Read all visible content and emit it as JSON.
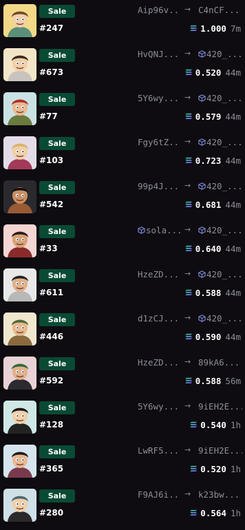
{
  "sales": [
    {
      "badge": "Sale",
      "number": "#247",
      "from": "Aip96v...",
      "from_icon": false,
      "to": "C4nCF...",
      "to_icon": false,
      "price": "1.000",
      "age": "7m",
      "colors": {
        "bg": "#f3d987",
        "skin": "#f1cfa8",
        "hair": "#6b4a2a",
        "shirt": "#5a8f7a"
      }
    },
    {
      "badge": "Sale",
      "number": "#673",
      "from": "HvQNJ...",
      "from_icon": false,
      "to": "420_...",
      "to_icon": true,
      "price": "0.520",
      "age": "44m",
      "colors": {
        "bg": "#f3e6c8",
        "skin": "#f1cfa8",
        "hair": "#3a2a22",
        "shirt": "#c8c3bd"
      }
    },
    {
      "badge": "Sale",
      "number": "#77",
      "from": "5Y6wy...",
      "from_icon": false,
      "to": "420_...",
      "to_icon": true,
      "price": "0.579",
      "age": "44m",
      "colors": {
        "bg": "#c9e3e4",
        "skin": "#e9b993",
        "hair": "#b22b2b",
        "shirt": "#6b7a3e"
      }
    },
    {
      "badge": "Sale",
      "number": "#103",
      "from": "Fgy6tZ...",
      "from_icon": false,
      "to": "420_...",
      "to_icon": true,
      "price": "0.723",
      "age": "44m",
      "colors": {
        "bg": "#e4dbe8",
        "skin": "#f1cfa8",
        "hair": "#d8b36a",
        "shirt": "#a33a5a"
      }
    },
    {
      "badge": "Sale",
      "number": "#542",
      "from": "99p4J...",
      "from_icon": false,
      "to": "420_...",
      "to_icon": true,
      "price": "0.681",
      "age": "44m",
      "colors": {
        "bg": "#2a2a2e",
        "skin": "#c98f63",
        "hair": "#111111",
        "shirt": "#9a5a33"
      }
    },
    {
      "badge": "Sale",
      "number": "#33",
      "from": "sola...",
      "from_icon": true,
      "to": "420_...",
      "to_icon": true,
      "price": "0.640",
      "age": "44m",
      "colors": {
        "bg": "#f4d6d2",
        "skin": "#d8a278",
        "hair": "#2a1e18",
        "shirt": "#8a2a2a"
      }
    },
    {
      "badge": "Sale",
      "number": "#611",
      "from": "HzeZD...",
      "from_icon": false,
      "to": "420_...",
      "to_icon": true,
      "price": "0.588",
      "age": "44m",
      "colors": {
        "bg": "#e8e8e8",
        "skin": "#e1b08a",
        "hair": "#222222",
        "shirt": "#b8b8b8"
      }
    },
    {
      "badge": "Sale",
      "number": "#446",
      "from": "d1zCJ...",
      "from_icon": false,
      "to": "420_...",
      "to_icon": true,
      "price": "0.590",
      "age": "44m",
      "colors": {
        "bg": "#f0e7cf",
        "skin": "#e8b890",
        "hair": "#4a6a3a",
        "shirt": "#8a6a3e"
      }
    },
    {
      "badge": "Sale",
      "number": "#592",
      "from": "HzeZD...",
      "from_icon": false,
      "to": "89kA6...",
      "to_icon": false,
      "price": "0.588",
      "age": "56m",
      "colors": {
        "bg": "#e8d2d6",
        "skin": "#e1b08a",
        "hair": "#2e6a3a",
        "shirt": "#2a2a30"
      }
    },
    {
      "badge": "Sale",
      "number": "#128",
      "from": "5Y6wy...",
      "from_icon": false,
      "to": "9iEH2E...",
      "to_icon": false,
      "price": "0.540",
      "age": "1h",
      "colors": {
        "bg": "#cfe8e6",
        "skin": "#f1cfa8",
        "hair": "#161616",
        "shirt": "#222222"
      }
    },
    {
      "badge": "Sale",
      "number": "#365",
      "from": "LwRF5...",
      "from_icon": false,
      "to": "9iEH2E...",
      "to_icon": false,
      "price": "0.520",
      "age": "1h",
      "colors": {
        "bg": "#d6e4ee",
        "skin": "#e9b993",
        "hair": "#1a1a1a",
        "shirt": "#7a3a4e"
      }
    },
    {
      "badge": "Sale",
      "number": "#280",
      "from": "F9AJ6i...",
      "from_icon": false,
      "to": "k23bw...",
      "to_icon": false,
      "price": "0.564",
      "age": "1h",
      "colors": {
        "bg": "#cfe0e6",
        "skin": "#f1cfa8",
        "hair": "#4a6a72",
        "shirt": "#2a2a2a"
      }
    }
  ]
}
